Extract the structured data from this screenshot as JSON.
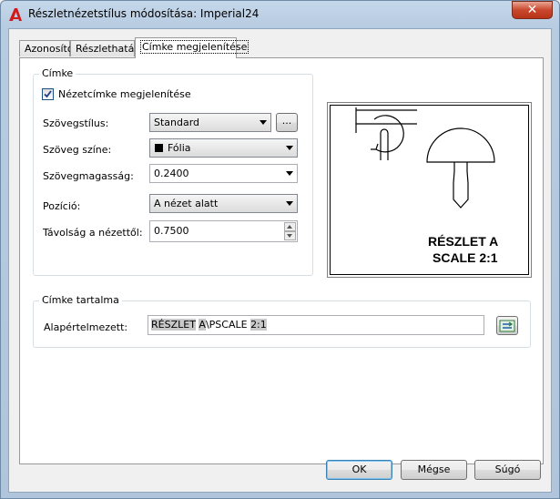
{
  "window": {
    "title": "Részletnézetstílus módosítása: Imperial24",
    "close_label": "✕"
  },
  "tabs": [
    {
      "label": "Azonosító"
    },
    {
      "label": "Részlethatár"
    },
    {
      "label": "Címke megjelenítése"
    }
  ],
  "label_group": {
    "legend": "Címke",
    "show_label": {
      "label": "Nézetcímke megjelenítése",
      "checked": true
    },
    "text_style": {
      "label": "Szövegstílus:",
      "value": "Standard",
      "browse_label": "..."
    },
    "text_color": {
      "label": "Szöveg színe:",
      "value": "Fólia",
      "swatch": "#000000"
    },
    "text_height": {
      "label": "Szövegmagasság:",
      "value": "0.2400"
    },
    "position": {
      "label": "Pozíció:",
      "value": "A nézet alatt"
    },
    "distance": {
      "label": "Távolság a nézettől:",
      "value": "0.7500"
    }
  },
  "preview": {
    "line1": "RÉSZLET A",
    "line2": "SCALE 2:1"
  },
  "content_group": {
    "legend": "Címke tartalma",
    "default_label": "Alapértelmezett:",
    "value_parts": [
      "RÉSZLET",
      " ",
      "A",
      "\\PSCALE ",
      "2:1"
    ],
    "field_icon": "insert-field-icon"
  },
  "buttons": {
    "ok": "OK",
    "cancel": "Mégse",
    "help": "Súgó"
  }
}
